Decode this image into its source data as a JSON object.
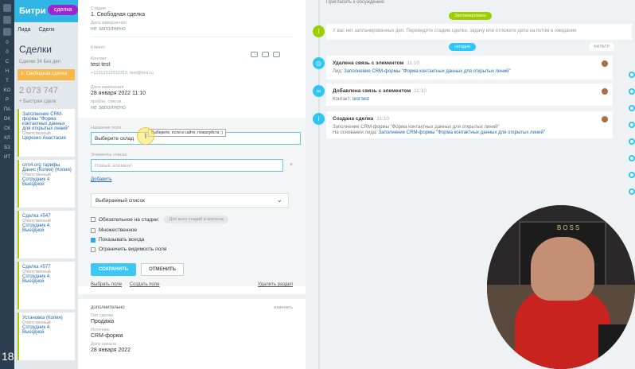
{
  "crm": {
    "app_title": "Битри",
    "deal_badge": "сделка",
    "tab_leads": "Лида",
    "tab_deals": "Сделк",
    "page_title": "Сделки",
    "stats": "Сделки  34  Без дел",
    "stage": "1. Свободная сделка",
    "sum": "2 073 747",
    "quick_add": "+ Быстрая сделк",
    "age_badge": "18+",
    "cards": [
      {
        "title": "Заполнение CRM-формы \"Форма контактных данных для открытых линий\"",
        "sub": "Ответственный",
        "person": "Церенко Анастасия"
      },
      {
        "title": "crm4.org тарифы Данис (Копия) (Копия)",
        "sub": "Ответственный",
        "person": "Сотрудник 4 Выездной"
      },
      {
        "title": "Сделка #547",
        "sub": "Ответственный",
        "person": "Сотрудник 4 Выездной"
      },
      {
        "title": "Сделка #577",
        "sub": "Ответственный",
        "person": "Сотрудник 4 Выездной"
      },
      {
        "title": "Установка (Копия)",
        "sub": "Ответственный",
        "person": "Сотрудник 4 Выездной"
      }
    ]
  },
  "rail_labels": [
    "0",
    "0",
    "C",
    "H",
    "T",
    "KO",
    "P",
    "ПА",
    "OK",
    "СК",
    "КЛ",
    "БЗ",
    "ИТ"
  ],
  "deal": {
    "stage_label": "Стадия",
    "stage_value": "1. Свободная сделка",
    "close_label": "Дата завершения",
    "close_value": "не заполнено",
    "client_label": "Клиент",
    "contact_label": "Контакт",
    "contact_name": "test test",
    "contact_info": "+12312312312312, test@test.ru",
    "modified_label": "Дата изменения",
    "modified_value": "28 января 2022 11:10",
    "prob_label": "пробле. список",
    "prob_value": "не заполнено"
  },
  "editor": {
    "field_name_label": "Название поля",
    "field_name_value": "Выберите склад",
    "tooltip": "Выберите, если в сайте, пожалуйста :)",
    "list_label": "Элементы списка",
    "list_placeholder": "Новый элемент",
    "add_link": "Добавить",
    "select_value": "Выбираемый список",
    "chk_required": "Обязательное на стадии:",
    "chk_required_pill": "Для всех стадий и воронок",
    "chk_multiple": "Множественное",
    "chk_show_always": "Показывать всегда",
    "chk_restrict": "Ограничить видимость поля",
    "save": "СОХРАНИТЬ",
    "cancel": "ОТМЕНИТЬ",
    "select_field": "Выбрать поле",
    "create_field": "Создать поле",
    "delete_section": "Удалить раздел"
  },
  "extra": {
    "header": "дополнительно",
    "edit": "изменить",
    "type_label": "Тип сделки",
    "type_value": "Продажа",
    "source_label": "Источник",
    "source_value": "CRM-форма",
    "start_label": "Дата начала",
    "start_value": "28 января 2022"
  },
  "timeline": {
    "top_text": "Пригласить к обсуждению",
    "planned_tag": "Запланировано",
    "notice": "У вас нет запланированных дел. Переведите стадию сделки, задачу или отложите дела на потом в ожидании",
    "today_tag": "сегодня",
    "filter": "ФИЛЬТР",
    "items": [
      {
        "title": "Удалена связь с элементом",
        "time": "11:10",
        "body_prefix": "Лид:",
        "body_link": "Заполнение CRM-формы \"Форма контактных данных для открытых линий\""
      },
      {
        "title": "Добавлена связь с элементом",
        "time": "11:10",
        "body_prefix": "Контакт:",
        "body_link": "test test"
      },
      {
        "title": "Создана сделка",
        "time": "11:10",
        "body_prefix": "Заполнение CRM-формы \"Форма контактных данных для открытых линий\"",
        "body_link": "Заполнение CRM-формы \"Форма контактных данных для открытых линий\"",
        "body2_prefix": "На основании лида:"
      }
    ]
  },
  "webcam": {
    "sign": "BOSS"
  },
  "colors": {
    "accent": "#2fc6f6",
    "green": "#9dcf00",
    "save_button": "#3bc8f5",
    "deal_badge": "#9c27d1"
  }
}
